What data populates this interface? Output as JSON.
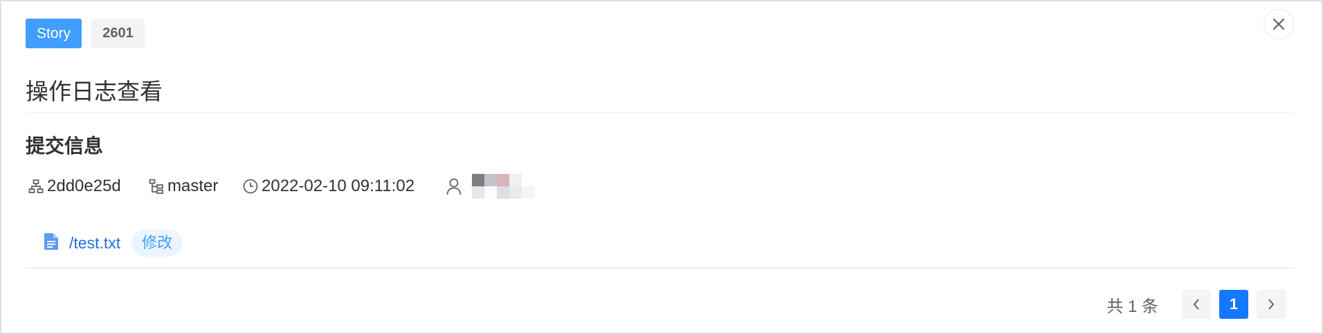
{
  "tags": {
    "type": "Story",
    "id": "2601"
  },
  "page_title": "操作日志查看",
  "section_title": "提交信息",
  "commit": {
    "hash": "2dd0e25d",
    "branch": "master",
    "time": "2022-02-10 09:11:02"
  },
  "files": [
    {
      "path": "/test.txt",
      "action": "修改"
    }
  ],
  "pagination": {
    "total_text": "共 1 条",
    "current_page": "1"
  },
  "icons": {
    "hash": "org-tree-icon",
    "branch": "branch-icon",
    "time": "clock-icon",
    "user": "user-icon",
    "file": "document-icon",
    "close": "close-icon",
    "prev": "chevron-left-icon",
    "next": "chevron-right-icon"
  },
  "colors": {
    "accent": "#409eff",
    "link": "#1e6fd9",
    "active_page": "#1677ff"
  }
}
